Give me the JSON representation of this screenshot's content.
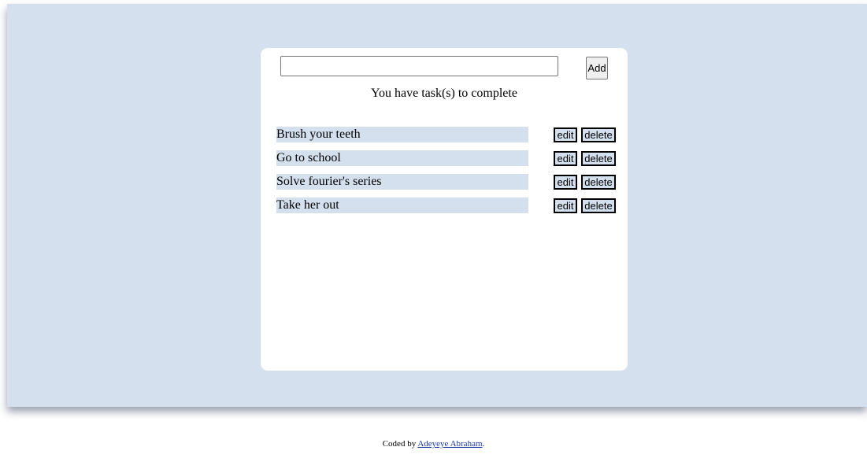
{
  "input": {
    "value": "",
    "placeholder": ""
  },
  "add_button_label": "Add",
  "status_text": "You have task(s) to complete",
  "tasks": [
    {
      "label": "Brush your teeth",
      "edit_label": "edit",
      "delete_label": "delete"
    },
    {
      "label": "Go to school",
      "edit_label": "edit",
      "delete_label": "delete"
    },
    {
      "label": "Solve fourier's series",
      "edit_label": "edit",
      "delete_label": "delete"
    },
    {
      "label": "Take her out",
      "edit_label": "edit",
      "delete_label": "delete"
    }
  ],
  "footer": {
    "prefix": "Coded by ",
    "author_link": "Adeyeye Abraham",
    "suffix": "."
  },
  "colors": {
    "background": "#d4e0ee",
    "card": "#ffffff",
    "task_highlight": "#d4e0ee",
    "link": "#1a3aa8"
  }
}
